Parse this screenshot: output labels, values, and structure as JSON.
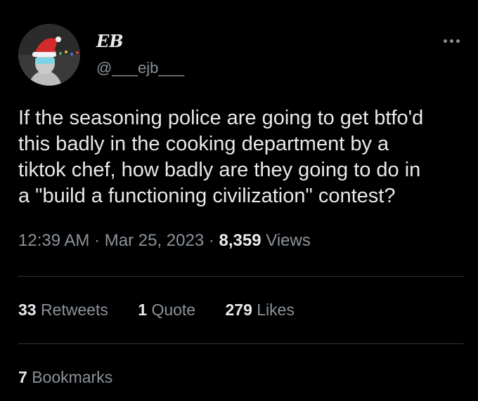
{
  "author": {
    "display_name": "EB",
    "handle": "@___ejb___",
    "avatar_icon": "avatar-santa-hat-icon"
  },
  "tweet": {
    "text": "If the seasoning police are going to get btfo'd\nthis badly in the cooking department by a\ntiktok chef, how badly are they going to do in\na \"build a functioning civilization\" contest?",
    "time": "12:39 AM",
    "separator": "·",
    "date": "Mar 25, 2023",
    "views_count": "8,359",
    "views_label": "Views"
  },
  "stats": {
    "retweets_count": "33",
    "retweets_label": "Retweets",
    "quotes_count": "1",
    "quotes_label": "Quote",
    "likes_count": "279",
    "likes_label": "Likes",
    "bookmarks_count": "7",
    "bookmarks_label": "Bookmarks"
  },
  "colors": {
    "background": "#000000",
    "primary_text": "#e7e9ea",
    "secondary_text": "#8b9299",
    "divider": "#2f3336"
  },
  "icons": {
    "more": "more-options-icon"
  }
}
